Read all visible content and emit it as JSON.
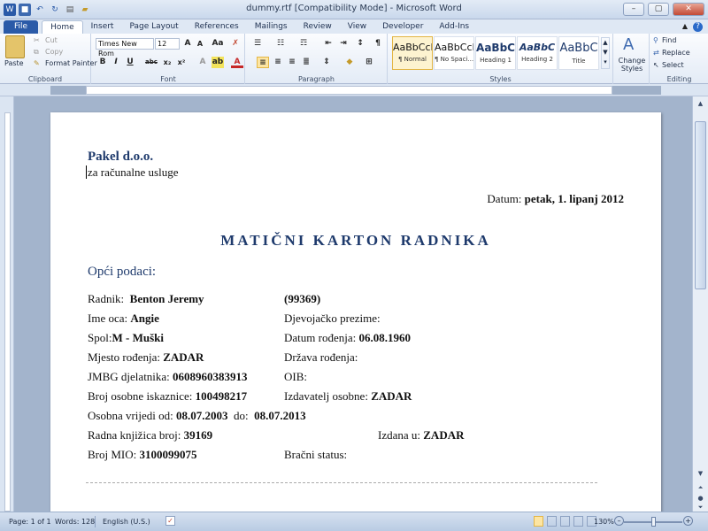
{
  "window": {
    "title": "dummy.rtf [Compatibility Mode] - Microsoft Word",
    "min": "–",
    "max": "▢",
    "close": "✕"
  },
  "tabs": [
    "File",
    "Home",
    "Insert",
    "Page Layout",
    "References",
    "Mailings",
    "Review",
    "View",
    "Developer",
    "Add-Ins"
  ],
  "ribbon": {
    "clipboard": {
      "paste": "Paste",
      "cut": "Cut",
      "copy": "Copy",
      "format_painter": "Format Painter",
      "label": "Clipboard"
    },
    "font": {
      "name": "Times New Rom",
      "size": "12",
      "bold": "B",
      "italic": "I",
      "underline": "U",
      "strike": "abc",
      "sub": "x₂",
      "sup": "x²",
      "label": "Font"
    },
    "paragraph": {
      "label": "Paragraph"
    },
    "styles": {
      "items": [
        {
          "sample": "AaBbCcI",
          "name": "¶ Normal"
        },
        {
          "sample": "AaBbCcI",
          "name": "¶ No Spaci..."
        },
        {
          "sample": "AaBbC",
          "name": "Heading 1"
        },
        {
          "sample": "AaBbC",
          "name": "Heading 2"
        },
        {
          "sample": "AaBbC",
          "name": "Title"
        }
      ],
      "change": "Change Styles",
      "label": "Styles"
    },
    "editing": {
      "find": "Find",
      "replace": "Replace",
      "select": "Select",
      "label": "Editing"
    }
  },
  "document": {
    "company": "Pakel d.o.o.",
    "subtitle": "za računalne usluge",
    "date_label": "Datum:",
    "date_value": "petak, 1. lipanj 2012",
    "title": "MATIČNI  KARTON RADNIKA",
    "section": "Opći podaci:",
    "fields": {
      "radnik_label": "Radnik:",
      "radnik_value": "Benton Jeremy",
      "radnik_id": "(99369)",
      "ime_oca_label": "Ime oca:",
      "ime_oca_value": "Angie",
      "djev_label": "Djevojačko prezime:",
      "spol_label": "Spol:",
      "spol_value": "M  -  Muški",
      "datum_rod_label": "Datum rođenja:",
      "datum_rod_value": "06.08.1960",
      "mjesto_label": "Mjesto rođenja:",
      "mjesto_value": "ZADAR",
      "drzava_label": "Država rođenja:",
      "jmbg_label": "JMBG djelatnika:",
      "jmbg_value": "0608960383913",
      "oib_label": "OIB:",
      "osobna_label": "Broj osobne iskaznice:",
      "osobna_value": "100498217",
      "izdavatelj_label": "Izdavatelj osobne:",
      "izdavatelj_value": "ZADAR",
      "vrijedi_label": "Osobna vrijedi od:",
      "vrijedi_od": "08.07.2003",
      "do_label": "do:",
      "vrijedi_do": "08.07.2013",
      "knjizica_label": "Radna knjižica broj:",
      "knjizica_value": "39169",
      "izdana_label": "Izdana u:",
      "izdana_value": "ZADAR",
      "mio_label": "Broj MIO:",
      "mio_value": "3100099075",
      "bracni_label": "Bračni status:"
    }
  },
  "status": {
    "page": "Page: 1 of 1",
    "words": "Words: 128",
    "lang": "English (U.S.)",
    "zoom": "130%"
  }
}
